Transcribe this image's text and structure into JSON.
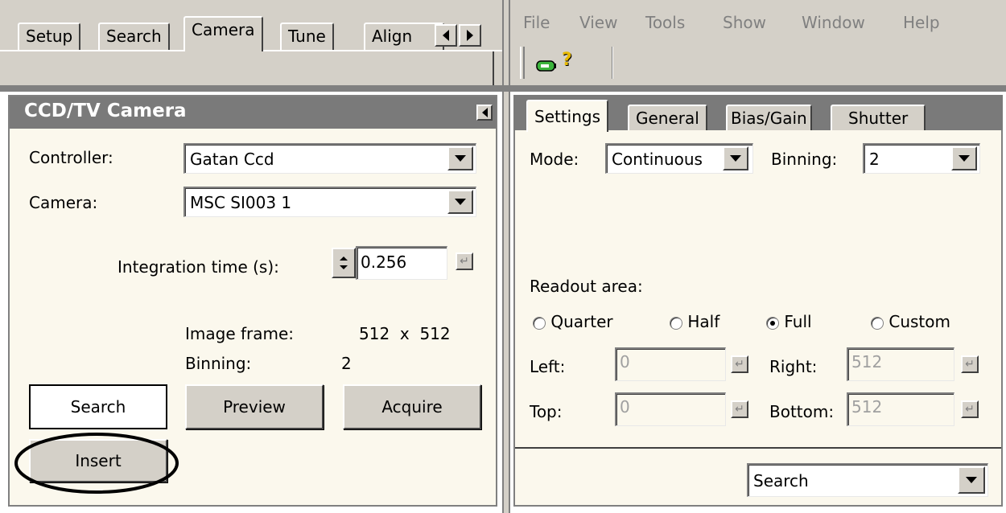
{
  "left_tabs": [
    "Setup",
    "Search",
    "Camera",
    "Tune",
    "Align"
  ],
  "menu": [
    "File",
    "View",
    "Tools",
    "Show",
    "Window",
    "Help"
  ],
  "camera_panel": {
    "title": "CCD/TV Camera",
    "controller_label": "Controller:",
    "controller_value": "Gatan Ccd",
    "camera_label": "Camera:",
    "camera_value": "MSC SI003 1",
    "integration_label": "Integration time (s):",
    "integration_value": "0.256",
    "image_frame_label": "Image frame:",
    "image_frame_value": "512  x  512",
    "binning_label": "Binning:",
    "binning_value": "2",
    "buttons": {
      "search": "Search",
      "preview": "Preview",
      "acquire": "Acquire",
      "insert": "Insert"
    }
  },
  "settings_panel": {
    "tabs": [
      "Settings",
      "General",
      "Bias/Gain",
      "Shutter"
    ],
    "mode_label": "Mode:",
    "mode_value": "Continuous",
    "binning_label": "Binning:",
    "binning_value": "2",
    "readout_label": "Readout area:",
    "readout_options": [
      "Quarter",
      "Half",
      "Full",
      "Custom"
    ],
    "readout_selected": "Full",
    "left_label": "Left:",
    "left_value": "0",
    "right_label": "Right:",
    "right_value": "512",
    "top_label": "Top:",
    "top_value": "0",
    "bottom_label": "Bottom:",
    "bottom_value": "512",
    "bottom_select": "Search"
  },
  "icons": {
    "toolbar": [
      "battery-icon",
      "help-icon"
    ],
    "annotation": "highlight-ellipse"
  }
}
